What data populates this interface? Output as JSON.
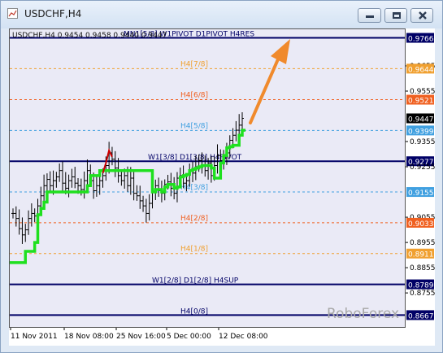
{
  "window": {
    "title": "USDCHF,H4",
    "header_symbol": "USDCHF,H4",
    "ohlc": "0.9454 0.9458 0.9440 0.9447",
    "watermark": "RoboForex",
    "icons": [
      "chart-window-icon",
      "minimize-icon",
      "maximize-icon",
      "close-icon",
      "arrow-up-icon"
    ]
  },
  "colors": {
    "plot_bg": "#eaeaf6",
    "candles": "#000000",
    "trend_line": "#1fe01f",
    "bear_segment": "#cc0000",
    "navy_level": "#000066",
    "arrow": "#f08a2c",
    "price_box": "#000000"
  },
  "chart_data": {
    "type": "line",
    "symbol": "USDCHF",
    "timeframe": "H4",
    "ylim": [
      0.862,
      0.98
    ],
    "price_ticks": [
      "0.9766",
      "0.9655",
      "0.9644",
      "0.9555",
      "0.9521",
      "0.9447",
      "0.9399",
      "0.9355",
      "0.9277",
      "0.9255",
      "0.9155",
      "0.9055",
      "0.9033",
      "0.8955",
      "0.8911",
      "0.8855",
      "0.8789",
      "0.8755",
      "0.8667"
    ],
    "time_ticks": [
      "11 Nov 2011",
      "18 Nov 08:00",
      "25 Nov 16:00",
      "5 Dec 00:00",
      "12 Dec 08:00"
    ],
    "current_price": "0.9447",
    "levels": [
      {
        "label": "MN1[5/8] W1PIVOT D1PIVOT H4RES",
        "value": 0.9766,
        "tag": "0.9766",
        "color": "#000066"
      },
      {
        "label": "H4[7/8]",
        "value": 0.9644,
        "tag": "0.9644",
        "color": "#f0a030"
      },
      {
        "label": "H4[6/8]",
        "value": 0.9521,
        "tag": "0.9521",
        "color": "#f06020"
      },
      {
        "label": "H4[5/8]",
        "value": 0.9399,
        "tag": "0.9399",
        "color": "#40a0e0"
      },
      {
        "label": "W1[3/8] D1[3/8] H4PIVOT",
        "value": 0.9277,
        "tag": "0.9277",
        "color": "#000066"
      },
      {
        "label": "H4[3/8]",
        "value": 0.9155,
        "tag": "0.9155",
        "color": "#40a0e0"
      },
      {
        "label": "H4[2/8]",
        "value": 0.9033,
        "tag": "0.9033",
        "color": "#f06020"
      },
      {
        "label": "H4[1/8]",
        "value": 0.8911,
        "tag": "0.8911",
        "color": "#f0a030"
      },
      {
        "label": "W1[2/8] D1[2/8] H4SUP",
        "value": 0.8789,
        "tag": "0.8789",
        "color": "#000066"
      },
      {
        "label": "H4[0/8]",
        "value": 0.8667,
        "tag": "0.8667",
        "color": "#000066"
      }
    ],
    "close_series": [
      0.907,
      0.905,
      0.901,
      0.8985,
      0.9005,
      0.905,
      0.907,
      0.906,
      0.91,
      0.914,
      0.918,
      0.9205,
      0.918,
      0.92,
      0.9215,
      0.924,
      0.919,
      0.917,
      0.92,
      0.9215,
      0.919,
      0.918,
      0.9165,
      0.92,
      0.924,
      0.92,
      0.916,
      0.918,
      0.92,
      0.922,
      0.926,
      0.931,
      0.9285,
      0.925,
      0.922,
      0.92,
      0.922,
      0.918,
      0.921,
      0.915,
      0.914,
      0.912,
      0.91,
      0.907,
      0.911,
      0.9155,
      0.918,
      0.916,
      0.915,
      0.9185,
      0.9195,
      0.917,
      0.915,
      0.921,
      0.922,
      0.919,
      0.92,
      0.924,
      0.923,
      0.9255,
      0.928,
      0.926,
      0.924,
      0.927,
      0.922,
      0.926,
      0.93,
      0.928,
      0.929,
      0.931,
      0.936,
      0.938,
      0.94,
      0.942,
      0.9447
    ],
    "trend_series": [
      0.8875,
      0.8875,
      0.8875,
      0.8875,
      0.892,
      0.892,
      0.892,
      0.8955,
      0.9065,
      0.909,
      0.9115,
      0.9155,
      0.9155,
      0.9155,
      0.9155,
      0.9155,
      0.9155,
      0.9155,
      0.9155,
      0.9155,
      0.9155,
      0.9155,
      0.9155,
      0.9155,
      0.918,
      0.922,
      0.922,
      0.922,
      0.924,
      0.924,
      0.924,
      0.924,
      0.924,
      0.924,
      0.924,
      0.924,
      0.924,
      0.924,
      0.924,
      0.924,
      0.924,
      0.924,
      0.924,
      0.924,
      0.924,
      0.9155,
      0.9165,
      0.9165,
      0.9155,
      0.9175,
      0.9185,
      0.9185,
      0.917,
      0.9175,
      0.9215,
      0.922,
      0.9225,
      0.924,
      0.9245,
      0.925,
      0.9255,
      0.926,
      0.926,
      0.926,
      0.925,
      0.921,
      0.921,
      0.927,
      0.93,
      0.933,
      0.9335,
      0.934,
      0.934,
      0.938,
      0.94
    ],
    "bear_segment_index": [
      29,
      32
    ]
  }
}
